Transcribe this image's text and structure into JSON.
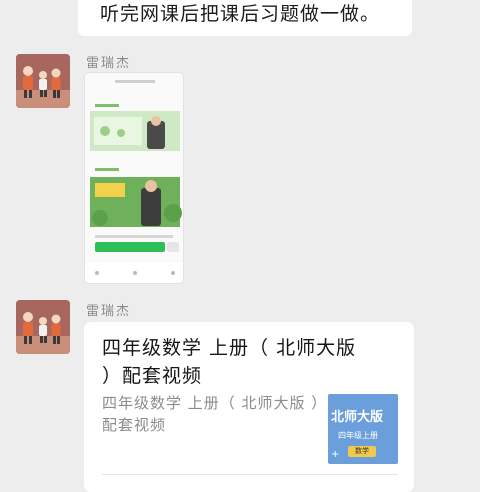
{
  "top_message": {
    "text": "听完网课后把课后习题做一做。"
  },
  "messages": [
    {
      "sender": "雷瑞杰",
      "type": "image"
    },
    {
      "sender": "雷瑞杰",
      "type": "link",
      "title": "四年级数学 上册（ 北师大版 ）配套视频",
      "description": "四年级数学 上册（ 北师大版 ）配套视频",
      "thumbnail": {
        "line1": "北师大版",
        "line2": "四年级上册",
        "line3": "数学"
      }
    }
  ],
  "colors": {
    "background": "#ededed",
    "bubble": "#ffffff",
    "sender": "#8a8a8a",
    "thumb": "#6a9fdc"
  }
}
